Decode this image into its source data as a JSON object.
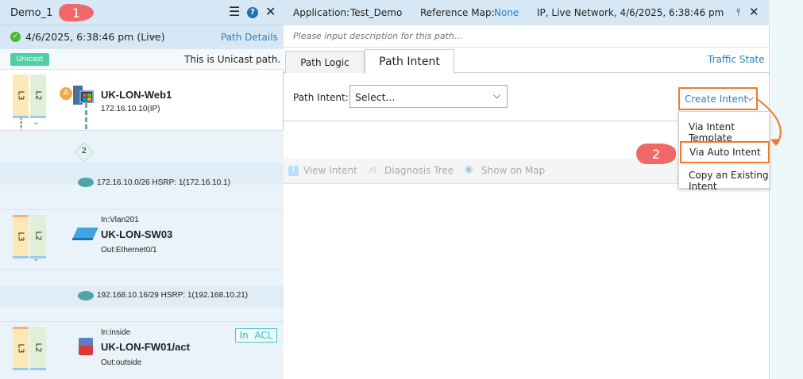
{
  "left_panel": {
    "title": "Demo_1",
    "timestamp": "4/6/2025, 6:38:46 pm (Live)",
    "path_details": "Path Details",
    "badge": "Unicast",
    "path_type_text": "This is Unicast path.",
    "layers": {
      "l3": "L3",
      "l2": "L2"
    },
    "hop_count": "2",
    "devices": [
      {
        "name": "UK-LON-Web1",
        "sub": "172.16.10.10(IP)",
        "marker": "A"
      },
      {
        "in": "In:Vlan201",
        "name": "UK-LON-SW03",
        "out": "Out:Ethernet0/1"
      },
      {
        "in": "In:inside",
        "name": "UK-LON-FW01/act",
        "out": "Out:outside",
        "acl": "In  ACL"
      }
    ],
    "subnets": [
      "172.16.10.0/26 HSRP: 1(172.16.10.1)",
      "192.168.10.16/29 HSRP: 1(192.168.10.21)"
    ]
  },
  "right_panel": {
    "application_label": "Application:",
    "application_value": "Test_Demo",
    "refmap_label": "Reference Map:",
    "refmap_value": "None",
    "status": "IP, Live Network, 4/6/2025, 6:38:46 pm",
    "description_placeholder": "Please input description for this path...",
    "tabs": [
      "Path Logic",
      "Path Intent"
    ],
    "traffic_state": "Traffic State",
    "path_intent_label": "Path Intent:",
    "select_value": "Select...",
    "create_intent": "Create Intent",
    "toolbar": [
      "View Intent",
      "Diagnosis Tree",
      "Show on Map"
    ],
    "menu": [
      "Via Intent Template",
      "Via Auto Intent",
      "Copy an Existing Intent"
    ]
  },
  "callouts": [
    "1",
    "2"
  ]
}
